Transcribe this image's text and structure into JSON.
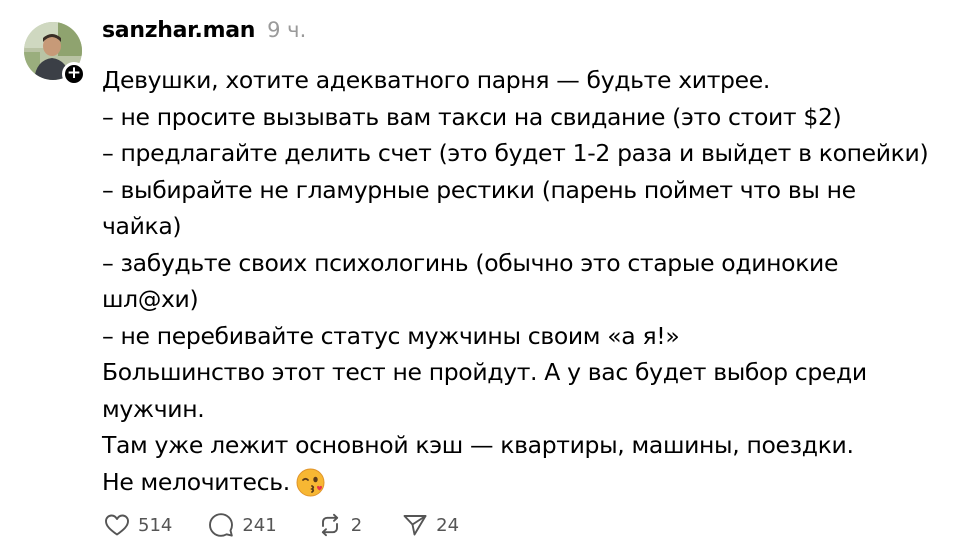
{
  "post": {
    "username": "sanzhar.man",
    "timestamp": "9 ч.",
    "lines": [
      "Девушки, хотите адекватного парня — будьте хитрее.",
      "– не просите вызывать вам такси на свидание (это стоит $2)",
      "– предлагайте делить счет (это будет 1-2 раза и выйдет в копейки)",
      "– выбирайте не гламурные рестики (парень поймет что вы не",
      "чайка)",
      "– забудьте своих психологинь (обычно это старые одинокие",
      "шл@хи)",
      "– не перебивайте статус мужчины своим «а я!»",
      "Большинство этот тест не пройдут. А у вас будет выбор среди",
      "мужчин.",
      "Там уже лежит основной кэш — квартиры, машины, поездки.",
      "Не мелочитесь."
    ],
    "emoji": "kissing-face-emoji"
  },
  "actions": {
    "likes": "514",
    "comments": "241",
    "reposts": "2",
    "shares": "24"
  },
  "icons": {
    "like": "heart-icon",
    "comment": "comment-bubble-icon",
    "repost": "repost-icon",
    "share": "send-icon",
    "follow": "plus-icon"
  },
  "colors": {
    "text": "#000000",
    "muted": "#9a9a9a",
    "action": "#555555",
    "emoji": "#f7b733"
  }
}
